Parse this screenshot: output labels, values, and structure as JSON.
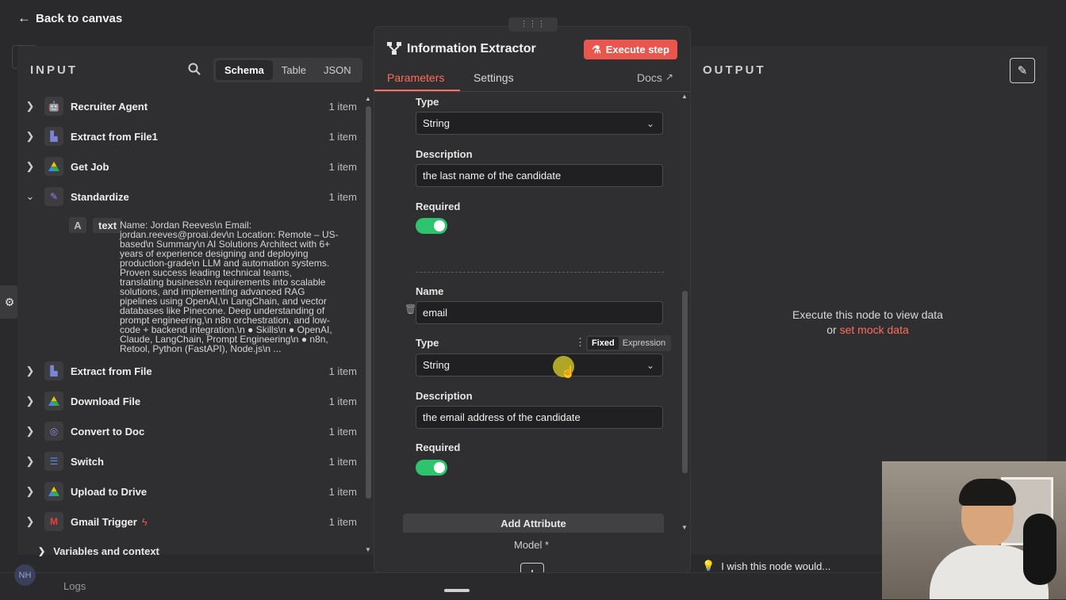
{
  "nav": {
    "back_label": "Back to canvas"
  },
  "input_panel": {
    "heading": "INPUT",
    "view_tabs": [
      "Schema",
      "Table",
      "JSON"
    ],
    "active_tab": "Schema",
    "nodes": [
      {
        "name": "Recruiter Agent",
        "count": "1 item",
        "icon": "robot-icon",
        "expanded": false
      },
      {
        "name": "Extract from File1",
        "count": "1 item",
        "icon": "file-extract-icon",
        "expanded": false
      },
      {
        "name": "Get Job",
        "count": "1 item",
        "icon": "google-drive-icon",
        "expanded": false
      },
      {
        "name": "Standardize",
        "count": "1 item",
        "icon": "pencil-icon",
        "expanded": true
      },
      {
        "name": "Extract from File",
        "count": "1 item",
        "icon": "file-extract-icon",
        "expanded": false
      },
      {
        "name": "Download File",
        "count": "1 item",
        "icon": "google-drive-icon",
        "expanded": false
      },
      {
        "name": "Convert to Doc",
        "count": "1 item",
        "icon": "globe-icon",
        "expanded": false
      },
      {
        "name": "Switch",
        "count": "1 item",
        "icon": "switch-icon",
        "expanded": false
      },
      {
        "name": "Upload to Drive",
        "count": "1 item",
        "icon": "google-drive-icon",
        "expanded": false
      },
      {
        "name": "Gmail Trigger",
        "count": "1 item",
        "icon": "gmail-icon",
        "expanded": false
      }
    ],
    "field_type_badge": "A",
    "field_name": "text",
    "field_value_lines": [
      "Name: Jordan Reeves\\n Email:",
      "jordan.reeves@proai.dev\\n Location: Remote – US-",
      "based\\n Summary\\n AI Solutions Architect with 6+",
      "years of experience designing and deploying",
      "production-grade\\n LLM and automation systems.",
      "Proven success leading technical teams,",
      "translating business\\n requirements into scalable",
      "solutions, and implementing advanced RAG",
      "pipelines using OpenAI,\\n LangChain, and vector",
      "databases like Pinecone. Deep understanding of",
      "prompt engineering,\\n n8n orchestration, and low-",
      "code + backend integration.\\n ● Skills\\n ● OpenAI,",
      "Claude, LangChain, Prompt Engineering\\n ● n8n,",
      "Retool, Python (FastAPI), Node.js\\n ..."
    ],
    "variables_label": "Variables and context"
  },
  "modal": {
    "title": "Information Extractor",
    "execute_label": "Execute step",
    "tabs": [
      "Parameters",
      "Settings"
    ],
    "active_tab": "Parameters",
    "docs_label": "Docs",
    "attr1": {
      "type_label": "Type",
      "type_value": "String",
      "desc_label": "Description",
      "desc_value": "the last name of the candidate",
      "required_label": "Required",
      "required": true
    },
    "attr2": {
      "name_label": "Name",
      "name_value": "email",
      "type_label": "Type",
      "type_value": "String",
      "mode_options": [
        "Fixed",
        "Expression"
      ],
      "mode_selected": "Fixed",
      "desc_label": "Description",
      "desc_value": "the email address of the candidate",
      "required_label": "Required",
      "required": true
    },
    "add_attribute_label": "Add Attribute",
    "model_label": "Model *"
  },
  "output_panel": {
    "heading": "OUTPUT",
    "empty_line1": "Execute this node to view data",
    "empty_or": "or",
    "mock_link": "set mock data"
  },
  "footer": {
    "feedback_label": "I wish this node would...",
    "logs_label": "Logs",
    "avatar_initials": "NH"
  },
  "colors": {
    "accent": "#e8564d",
    "toggle_on": "#2ec46e",
    "link": "#ff6d5a"
  }
}
